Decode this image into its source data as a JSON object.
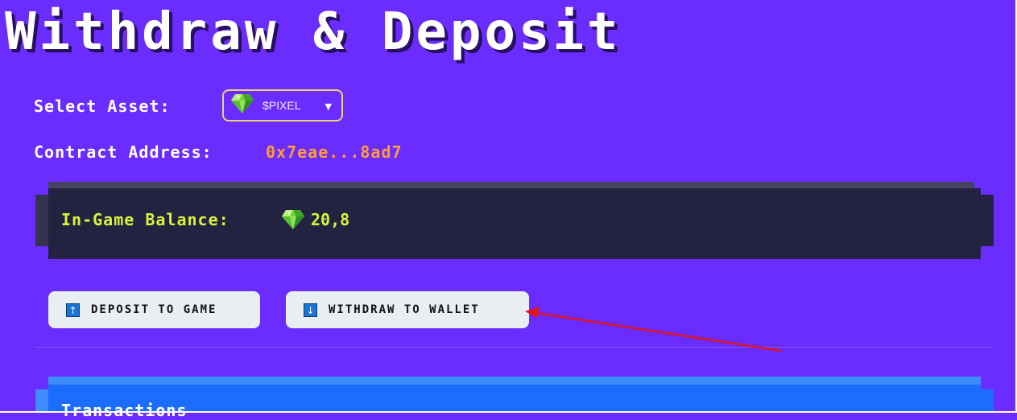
{
  "page": {
    "title": "Withdraw & Deposit"
  },
  "asset": {
    "label": "Select Asset:",
    "selected": "$PIXEL",
    "icon": "gem-icon"
  },
  "contract": {
    "label": "Contract Address:",
    "value": "0x7eae...8ad7"
  },
  "balance": {
    "label": "In-Game Balance:",
    "value": "20,8",
    "icon": "gem-icon"
  },
  "actions": {
    "deposit_label": "DEPOSIT TO GAME",
    "deposit_icon": "arrow-up-icon",
    "withdraw_label": "WITHDRAW TO WALLET",
    "withdraw_icon": "arrow-down-icon"
  },
  "transactions": {
    "title": "Transactions"
  },
  "annotation": {
    "type": "red-arrow",
    "points_to": "withdraw-to-wallet-button"
  },
  "colors": {
    "background": "#6a2cff",
    "contract_address": "#ff9c3a",
    "balance_text": "#d8f53a",
    "balance_panel": "#232341",
    "transactions_panel": "#1a6dff",
    "button_bg": "#e8eef2",
    "annotation_arrow": "#e0141e"
  }
}
